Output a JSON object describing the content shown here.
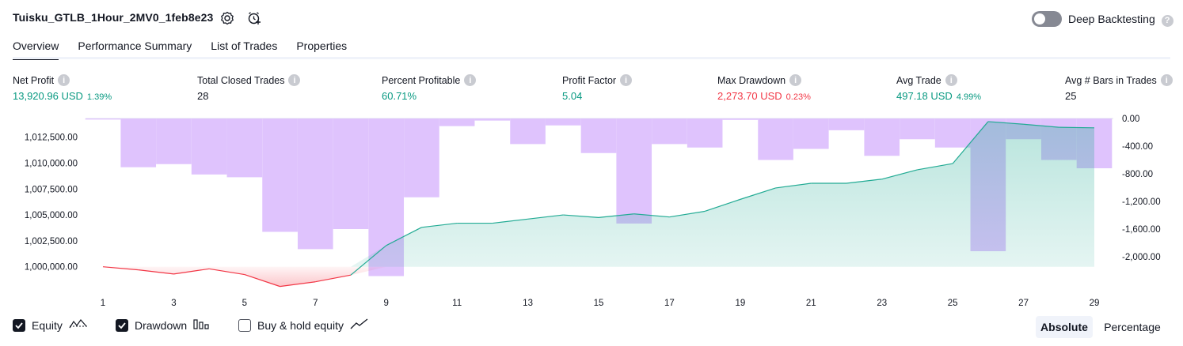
{
  "header": {
    "title": "Tuisku_GTLB_1Hour_2MV0_1feb8e23",
    "deep_backtesting_label": "Deep Backtesting",
    "deep_backtesting_on": false
  },
  "tabs": [
    {
      "label": "Overview",
      "active": true
    },
    {
      "label": "Performance Summary",
      "active": false
    },
    {
      "label": "List of Trades",
      "active": false
    },
    {
      "label": "Properties",
      "active": false
    }
  ],
  "metrics": [
    {
      "label": "Net Profit",
      "value": "13,920.96 USD",
      "pct": "1.39%",
      "color": "#089981"
    },
    {
      "label": "Total Closed Trades",
      "value": "28",
      "pct": "",
      "color": "#131722"
    },
    {
      "label": "Percent Profitable",
      "value": "60.71%",
      "pct": "",
      "color": "#089981"
    },
    {
      "label": "Profit Factor",
      "value": "5.04",
      "pct": "",
      "color": "#089981"
    },
    {
      "label": "Max Drawdown",
      "value": "2,273.70 USD",
      "pct": "0.23%",
      "color": "#f23645"
    },
    {
      "label": "Avg Trade",
      "value": "497.18 USD",
      "pct": "4.99%",
      "color": "#089981"
    },
    {
      "label": "Avg # Bars in Trades",
      "value": "25",
      "pct": "",
      "color": "#131722"
    }
  ],
  "chart_data": {
    "type": "line",
    "x_tick_labels": [
      "1",
      "3",
      "5",
      "7",
      "9",
      "11",
      "13",
      "15",
      "17",
      "19",
      "21",
      "23",
      "25",
      "27",
      "29"
    ],
    "left_axis": {
      "tick_labels": [
        "1,012,500.00",
        "1,010,000.00",
        "1,007,500.00",
        "1,005,000.00",
        "1,002,500.00",
        "1,000,000.00"
      ],
      "range": [
        998300,
        1014300
      ]
    },
    "right_axis": {
      "tick_labels": [
        "0.00",
        "-400.00",
        "-800.00",
        "-1,200.00",
        "-1,600.00",
        "-2,000.00"
      ],
      "range": [
        -2400,
        0
      ]
    },
    "series": [
      {
        "name": "Equity",
        "axis": "left",
        "x": [
          1,
          2,
          3,
          4,
          5,
          6,
          7,
          8,
          9,
          10,
          11,
          12,
          13,
          14,
          15,
          16,
          17,
          18,
          19,
          20,
          21,
          22,
          23,
          24,
          25,
          26,
          27,
          28,
          29
        ],
        "values": [
          1000000,
          999700,
          999300,
          999800,
          999250,
          998100,
          998550,
          999200,
          1002050,
          1003800,
          1004200,
          1004200,
          1004600,
          1005000,
          1004750,
          1005100,
          1004800,
          1005350,
          1006500,
          1007600,
          1008050,
          1008050,
          1008450,
          1009350,
          1009950,
          1014000,
          1013750,
          1013450,
          1013400
        ]
      },
      {
        "name": "Drawdown",
        "axis": "right",
        "x": [
          1,
          2,
          3,
          4,
          5,
          6,
          7,
          8,
          9,
          10,
          11,
          12,
          13,
          14,
          15,
          16,
          17,
          18,
          19,
          20,
          21,
          22,
          23,
          24,
          25,
          26,
          27,
          28,
          29
        ],
        "values": [
          -15,
          -705,
          -660,
          -810,
          -850,
          -1640,
          -1890,
          -1600,
          -2280,
          -1140,
          -110,
          -30,
          -370,
          -100,
          -500,
          -1520,
          -370,
          -420,
          -20,
          -600,
          -440,
          -170,
          -540,
          -300,
          -420,
          -1920,
          -300,
          -600,
          -720
        ]
      }
    ],
    "legend": [
      {
        "label": "Equity",
        "checked": true,
        "icon": "equity-line-icon"
      },
      {
        "label": "Drawdown",
        "checked": true,
        "icon": "drawdown-bars-icon"
      },
      {
        "label": "Buy & hold equity",
        "checked": false,
        "icon": "trend-line-icon"
      }
    ],
    "colors": {
      "equity_up": "#22ab94",
      "equity_down": "#f23645",
      "drawdown_bar": "#d9b8fd",
      "equity_fill": "#d3eee8"
    }
  },
  "view_mode": {
    "options": [
      "Absolute",
      "Percentage"
    ],
    "selected": "Absolute"
  }
}
